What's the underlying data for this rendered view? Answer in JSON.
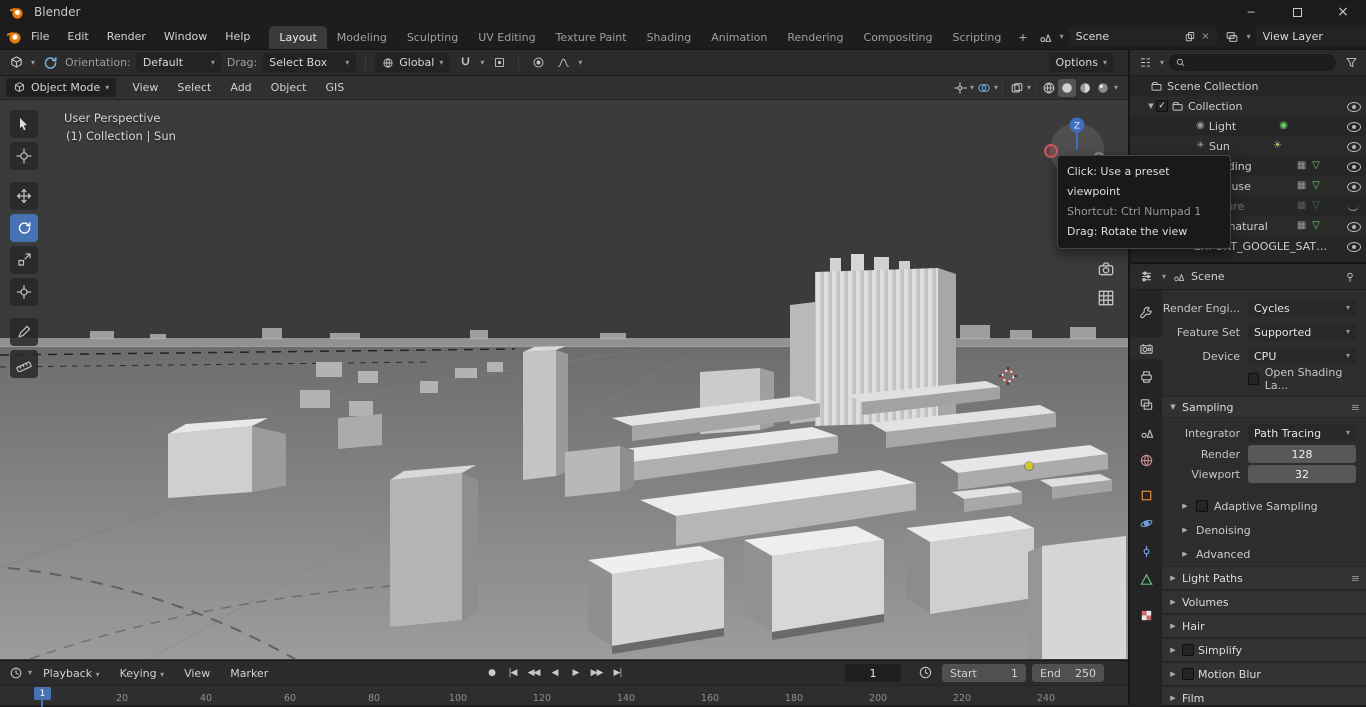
{
  "titlebar": {
    "title": "Blender"
  },
  "icons": {
    "dropdown": "▾",
    "collapse_open": "▼",
    "collapse_closed": "▶",
    "check": "✓",
    "close": "×",
    "minimize": "─",
    "sun": "☀",
    "point_light": "◉",
    "mesh": "▽",
    "instance": "▦",
    "list": "≡",
    "plus": "+"
  },
  "menubar": {
    "items": [
      "File",
      "Edit",
      "Render",
      "Window",
      "Help"
    ]
  },
  "workspaces": {
    "tabs": [
      "Layout",
      "Modeling",
      "Sculpting",
      "UV Editing",
      "Texture Paint",
      "Shading",
      "Animation",
      "Rendering",
      "Compositing",
      "Scripting"
    ],
    "add": "+"
  },
  "scene_selector": {
    "value": "Scene"
  },
  "view_layer_selector": {
    "value": "View Layer"
  },
  "tool_settings": {
    "orientation_label": "Orientation:",
    "orientation_value": "Default",
    "drag_label": "Drag:",
    "drag_value": "Select Box",
    "transform_space": "Global",
    "options": "Options"
  },
  "viewport": {
    "mode": "Object Mode",
    "menus": [
      "View",
      "Select",
      "Add",
      "Object",
      "GIS"
    ],
    "overlay_line1": "User Perspective",
    "overlay_line2": "(1) Collection | Sun",
    "gizmo_z": "Z",
    "tooltip": {
      "click": "Click: Use a preset viewpoint",
      "shortcut": "Shortcut: Ctrl Numpad 1",
      "drag": "Drag: Rotate the view"
    }
  },
  "outliner": {
    "rows": [
      {
        "label": "Scene Collection"
      },
      {
        "label": "Collection"
      },
      {
        "label": "Light"
      },
      {
        "label": "Sun"
      },
      {
        "label": "building"
      },
      {
        "label": "landuse"
      },
      {
        "label": "leisure"
      },
      {
        "label": "Areas:natural"
      },
      {
        "label": "EXPORT_GOOGLE_SAT_WM"
      }
    ]
  },
  "properties": {
    "breadcrumb": "Scene",
    "render_engine_label": "Render Engi...",
    "render_engine": "Cycles",
    "feature_set_label": "Feature Set",
    "feature_set": "Supported",
    "device_label": "Device",
    "device": "CPU",
    "osl": "Open Shading La...",
    "sampling": "Sampling",
    "integrator_label": "Integrator",
    "integrator": "Path Tracing",
    "render_label": "Render",
    "render_samples": "128",
    "viewport_label": "Viewport",
    "viewport_samples": "32",
    "adaptive_sampling": "Adaptive Sampling",
    "denoising": "Denoising",
    "advanced": "Advanced",
    "light_paths": "Light Paths",
    "volumes": "Volumes",
    "hair": "Hair",
    "simplify": "Simplify",
    "motion_blur": "Motion Blur",
    "film": "Film"
  },
  "timeline": {
    "menus": [
      "Playback",
      "Keying",
      "View",
      "Marker"
    ],
    "transport": [
      "●",
      "|◀",
      "◀◀",
      "◀",
      "▶",
      "▶▶",
      "▶|"
    ],
    "current_frame": "1",
    "playhead_label": "1",
    "start_label": "Start",
    "start_value": "1",
    "end_label": "End",
    "end_value": "250",
    "ruler": [
      "20",
      "40",
      "60",
      "80",
      "100",
      "120",
      "140",
      "160",
      "180",
      "200",
      "220",
      "240"
    ]
  }
}
